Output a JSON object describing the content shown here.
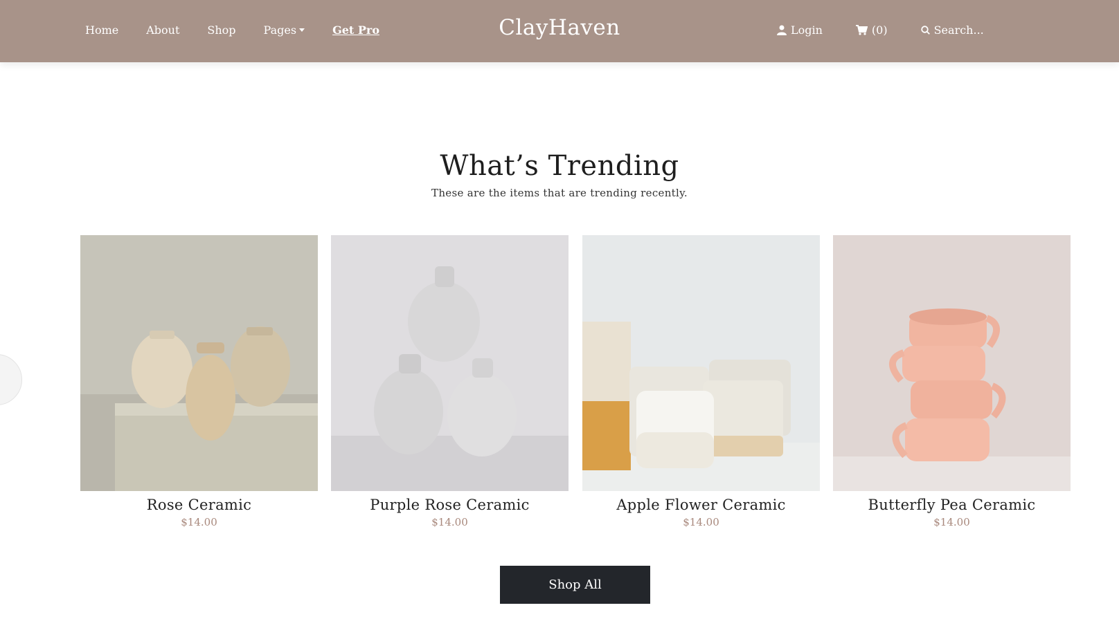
{
  "header": {
    "brand": "ClayHaven",
    "nav": {
      "home": "Home",
      "about": "About",
      "shop": "Shop",
      "pages": "Pages",
      "get_pro": "Get Pro"
    },
    "login": "Login",
    "cart": "(0)",
    "search_placeholder": "Search..."
  },
  "trending": {
    "title": "What’s Trending",
    "subtitle": "These are the items that are trending recently."
  },
  "products": [
    {
      "name": "Rose Ceramic",
      "price": "$14.00"
    },
    {
      "name": "Purple Rose Ceramic",
      "price": "$14.00"
    },
    {
      "name": "Apple Flower Ceramic",
      "price": "$14.00"
    },
    {
      "name": "Butterfly Pea Ceramic",
      "price": "$14.00"
    }
  ],
  "cta": {
    "shop_all": "Shop All"
  },
  "colors": {
    "header_bg": "#a89389",
    "price": "#a8887c",
    "button_bg": "#23262b"
  }
}
